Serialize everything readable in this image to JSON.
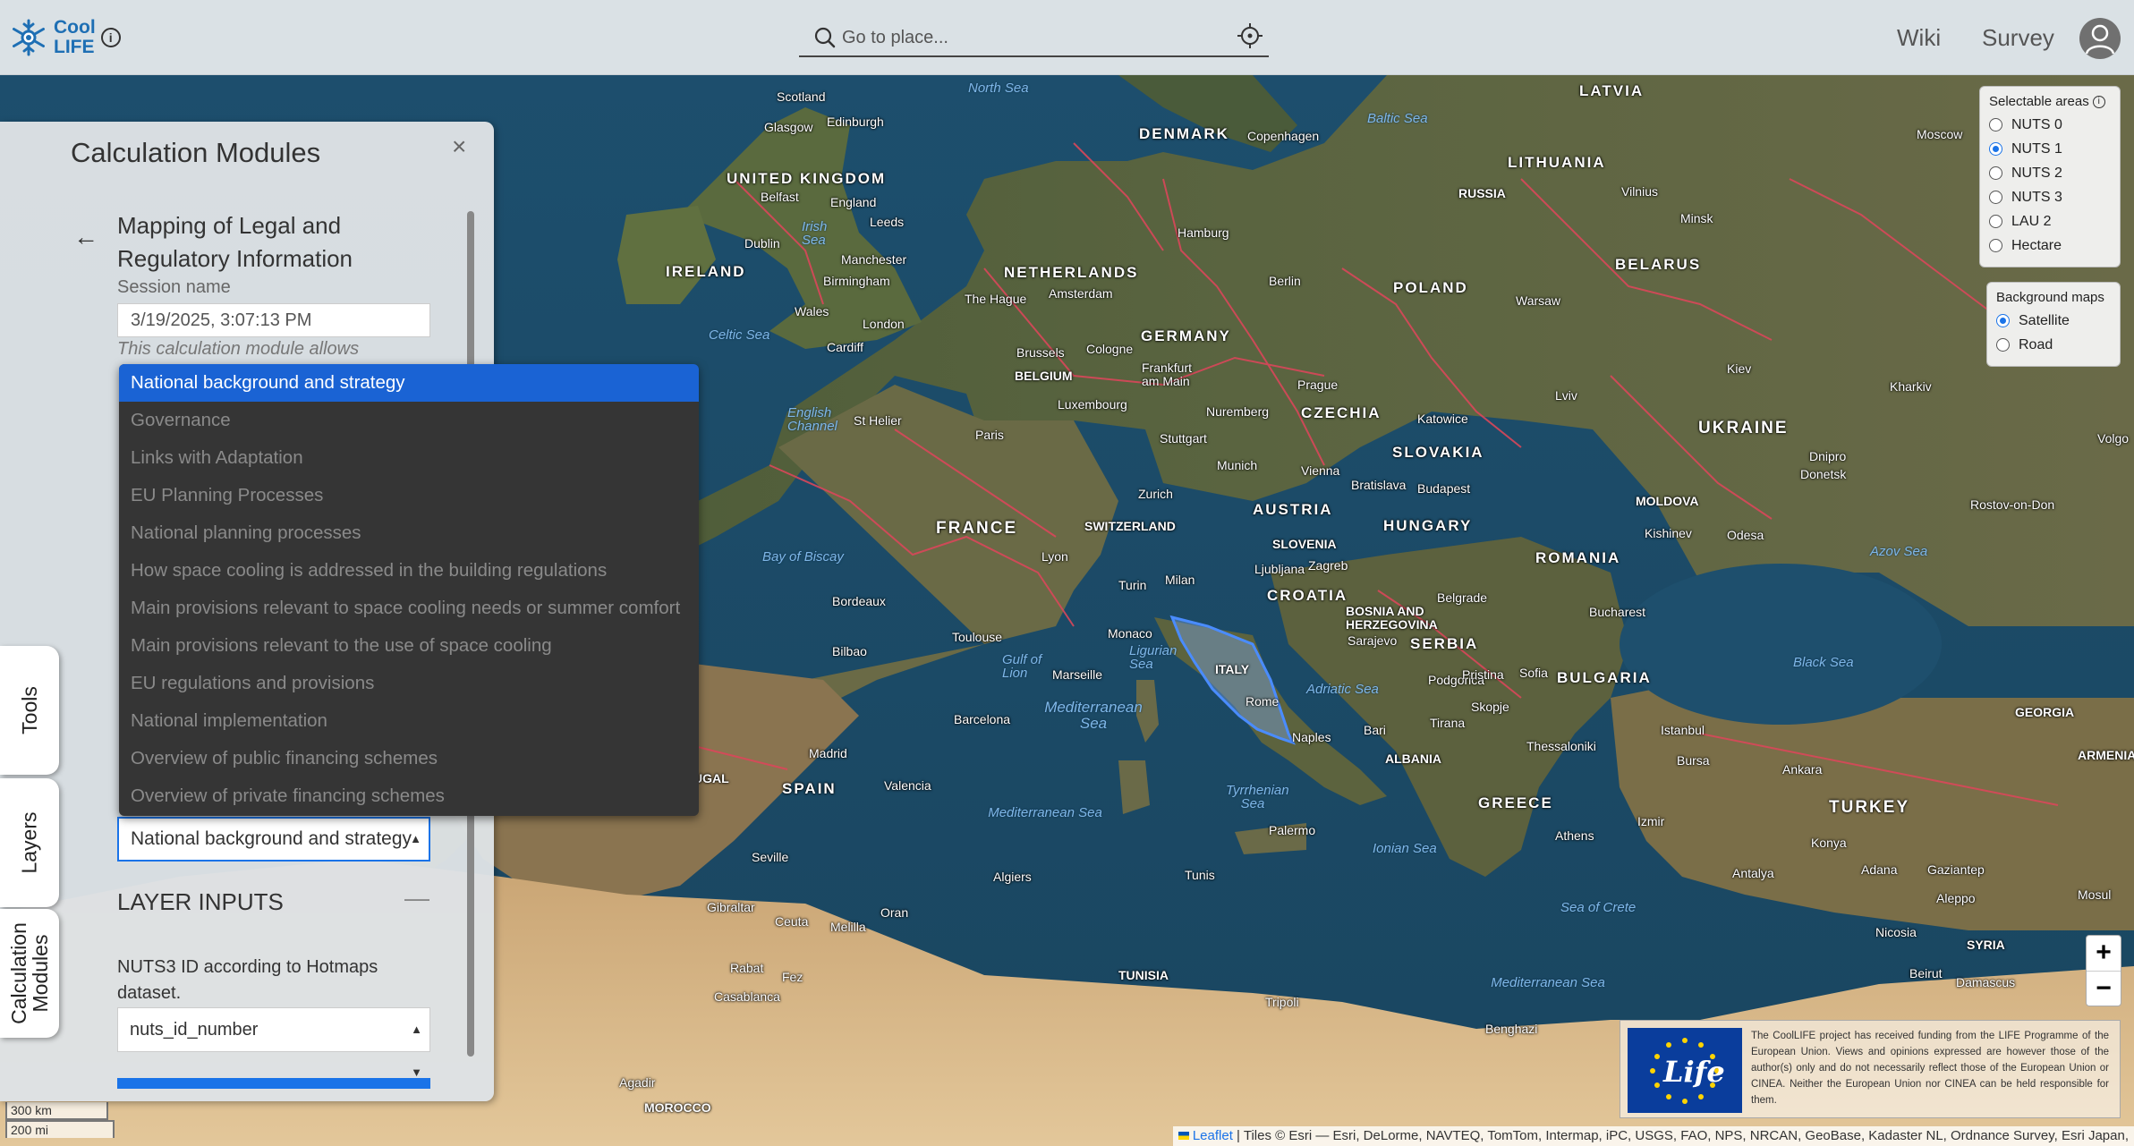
{
  "app": {
    "brand_line1": "Cool",
    "brand_line2": "LIFE",
    "info_glyph": "i"
  },
  "search": {
    "placeholder": "Go to place..."
  },
  "nav": {
    "wiki": "Wiki",
    "survey": "Survey"
  },
  "selectable_areas": {
    "title": "Selectable areas",
    "options": [
      "NUTS 0",
      "NUTS 1",
      "NUTS 2",
      "NUTS 3",
      "LAU 2",
      "Hectare"
    ],
    "selected": "NUTS 1"
  },
  "background_maps": {
    "title": "Background maps",
    "options": [
      "Satellite",
      "Road"
    ],
    "selected": "Satellite"
  },
  "zoom": {
    "in": "+",
    "out": "−"
  },
  "side_tabs": {
    "tools": "Tools",
    "layers": "Layers",
    "calc_modules_line1": "Calculation",
    "calc_modules_line2": "Modules"
  },
  "panel": {
    "title": "Calculation Modules",
    "close": "×",
    "back": "←",
    "module_title": "Mapping of Legal and Regulatory Information",
    "session_label": "Session name",
    "session_value": "3/19/2025, 3:07:13 PM",
    "allows_text": "This calculation module allows",
    "select_value": "National background and strategy",
    "layer_inputs": "LAYER INPUTS",
    "collapse": "—",
    "nuts_label": "NUTS3 ID according to Hotmaps dataset.",
    "nuts_select_value": "nuts_id_number"
  },
  "dropdown": {
    "items": [
      "National background and strategy",
      "Governance",
      "Links with Adaptation",
      "EU Planning Processes",
      "National planning processes",
      "How space cooling is addressed in the building regulations",
      "Main provisions relevant to space cooling needs or summer comfort",
      "Main provisions relevant to the use of space cooling",
      "EU regulations and provisions",
      "National implementation",
      "Overview of public financing schemes",
      "Overview of private financing schemes"
    ],
    "selected_index": 0
  },
  "eu_banner": {
    "logo_text": "Life",
    "text": "The CoolLIFE project has received funding from the LIFE Programme of the European Union. Views and opinions expressed are however those of the author(s) only and do not necessarily reflect those of the European Union or CINEA. Neither the European Union nor CINEA can be held responsible for them."
  },
  "scale": {
    "km": "300 km",
    "mi": "200 mi"
  },
  "attribution": {
    "leaflet": "Leaflet",
    "rest": " | Tiles © Esri — Esri, DeLorme, NAVTEQ, TomTom, Intermap, iPC, USGS, FAO, NPS, NRCAN, GeoBase, Kadaster NL, Ordnance Survey, Esri Japan,"
  },
  "map_labels": {
    "countries": [
      "UNITED KINGDOM",
      "IRELAND",
      "DENMARK",
      "LATVIA",
      "LITHUANIA",
      "RUSSIA",
      "BELARUS",
      "POLAND",
      "NETHERLANDS",
      "BELGIUM",
      "GERMANY",
      "CZECHIA",
      "SLOVAKIA",
      "UKRAINE",
      "FRANCE",
      "SWITZERLAND",
      "AUSTRIA",
      "HUNGARY",
      "MOLDOVA",
      "ROMANIA",
      "SLOVENIA",
      "CROATIA",
      "BOSNIA AND HERZEGOVINA",
      "SERBIA",
      "BULGARIA",
      "ITALY",
      "ALBANIA",
      "GREECE",
      "TURKEY",
      "SPAIN",
      "TUNISIA",
      "MOROCCO",
      "SYRIA",
      "GEORGIA",
      "ARMENIA",
      "UGAL"
    ],
    "cities": [
      "Scotland",
      "Glasgow",
      "Edinburgh",
      "Belfast",
      "England",
      "Leeds",
      "Dublin",
      "Manchester",
      "Wales",
      "Birmingham",
      "London",
      "Cardiff",
      "Copenhagen",
      "Hamburg",
      "Berlin",
      "Amsterdam",
      "The Hague",
      "Brussels",
      "Cologne",
      "Frankfurt am Main",
      "Luxembourg",
      "Prague",
      "Katowice",
      "Warsaw",
      "Vilnius",
      "Minsk",
      "Moscow",
      "Kiev",
      "Kharkiv",
      "Lviv",
      "Paris",
      "Stuttgart",
      "Nuremberg",
      "Munich",
      "Vienna",
      "Bratislava",
      "Budapest",
      "Zurich",
      "Lyon",
      "Turin",
      "Milan",
      "Ljubljana",
      "Zagreb",
      "Sarajevo",
      "Belgrade",
      "Bucharest",
      "Odesa",
      "Dnipro",
      "Donetsk",
      "Rostov-on-Don",
      "Kishinev",
      "Bordeaux",
      "Toulouse",
      "Bilbao",
      "Marseille",
      "Monaco",
      "Rome",
      "Naples",
      "Bari",
      "Podgorica",
      "Pristina",
      "Skopje",
      "Sofia",
      "Tirana",
      "Thessaloniki",
      "Istanbul",
      "Bursa",
      "Izmir",
      "Ankara",
      "Athens",
      "Barcelona",
      "Madrid",
      "Valencia",
      "Seville",
      "Gibraltar",
      "Ceuta",
      "Melilla",
      "Oran",
      "Algiers",
      "Tunis",
      "Palermo",
      "Tripoli",
      "Benghazi",
      "Rabat",
      "Fez",
      "Casablanca",
      "Agadir",
      "Konya",
      "Adana",
      "Gaziantep",
      "Aleppo",
      "Mosul",
      "Nicosia",
      "Beirut",
      "Damascus",
      "Antalya",
      "St Helier",
      "Volgo"
    ],
    "seas": [
      "North Sea",
      "Baltic Sea",
      "Irish Sea",
      "Celtic Sea",
      "English Channel",
      "Bay of Biscay",
      "Mediterranean Sea",
      "Ligurian Sea",
      "Gulf of Lion",
      "Tyrrhenian Sea",
      "Adriatic Sea",
      "Ionian Sea",
      "Sea of Crete",
      "Black Sea",
      "Azov Sea"
    ]
  },
  "colors": {
    "accent": "#1a73e8",
    "border_lines": "#d9475a",
    "highlight": "#4a8cff",
    "dropdown_bg": "#353535"
  }
}
